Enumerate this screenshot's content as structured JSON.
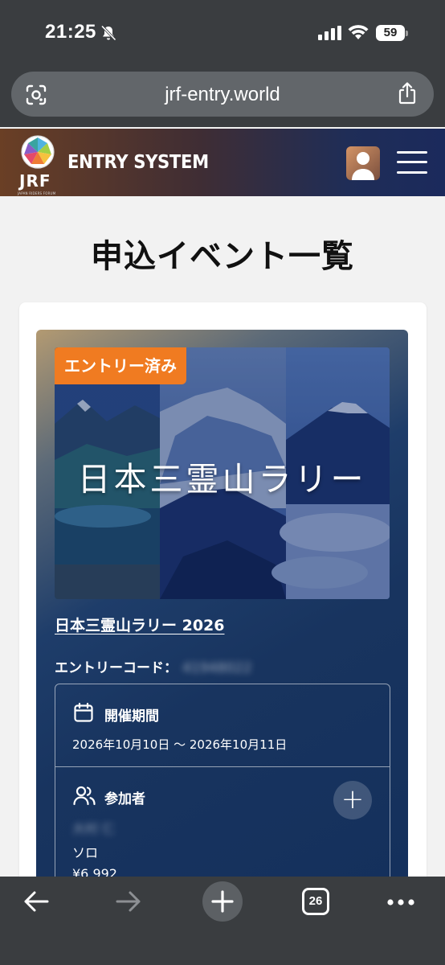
{
  "status_bar": {
    "time": "21:25",
    "battery": "59"
  },
  "browser": {
    "url": "jrf-entry.world",
    "tab_count": "26"
  },
  "header": {
    "logo_text": "JRF",
    "logo_subtext": "JAPAN RIDERS FORUM",
    "title": "ENTRY SYSTEM"
  },
  "page": {
    "heading": "申込イベント一覧"
  },
  "event": {
    "status_badge": "エントリー済み",
    "image_title": "日本三霊山ラリー",
    "name": "日本三霊山ラリー 2026",
    "entry_code_label": "エントリーコード：",
    "entry_code_value": "41948022",
    "period_label": "開催期間",
    "period_value": "2026年10月10日 〜 2026年10月11日",
    "participants_label": "参加者",
    "participant_name": "大村 仁",
    "participant_type": "ソロ",
    "participant_price": "¥6,992"
  },
  "colors": {
    "badge": "#f07b21",
    "header_start": "#6a3f25",
    "header_end": "#1b2a5c",
    "card_bg": "#18345f"
  }
}
